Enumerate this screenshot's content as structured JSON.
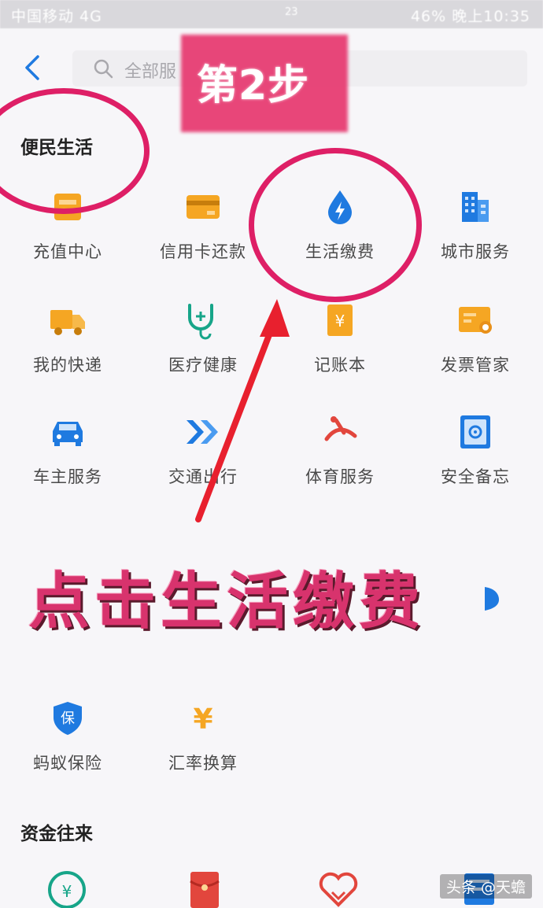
{
  "status_bar": {
    "carrier": "中国移动 4G",
    "middle": "23",
    "right": "46%   晚上10:35"
  },
  "header": {
    "back_icon": "chevron-left-icon",
    "search_placeholder": "全部服",
    "step_label": "第2步"
  },
  "sections": {
    "convenience_title": "便民生活",
    "funds_title": "资金往来"
  },
  "convenience_items": [
    {
      "label": "充值中心",
      "icon": "recharge-card-icon"
    },
    {
      "label": "信用卡还款",
      "icon": "credit-card-icon"
    },
    {
      "label": "生活缴费",
      "icon": "water-drop-bolt-icon"
    },
    {
      "label": "城市服务",
      "icon": "city-buildings-icon"
    },
    {
      "label": "我的快递",
      "icon": "delivery-truck-icon"
    },
    {
      "label": "医疗健康",
      "icon": "stethoscope-icon"
    },
    {
      "label": "记账本",
      "icon": "ledger-book-icon"
    },
    {
      "label": "发票管家",
      "icon": "invoice-icon"
    },
    {
      "label": "车主服务",
      "icon": "car-icon"
    },
    {
      "label": "交通出行",
      "icon": "transport-arrows-icon"
    },
    {
      "label": "体育服务",
      "icon": "sports-icon"
    },
    {
      "label": "安全备忘",
      "icon": "safe-box-icon"
    },
    {
      "label": "蚂蚁保险",
      "icon": "insurance-shield-icon"
    },
    {
      "label": "汇率换算",
      "icon": "exchange-rate-icon"
    }
  ],
  "caption": "点击生活缴费",
  "watermark": "头条 @天蟾",
  "colors": {
    "highlight": "#de1f66",
    "blue": "#1f7ae0",
    "orange": "#f5a623"
  }
}
